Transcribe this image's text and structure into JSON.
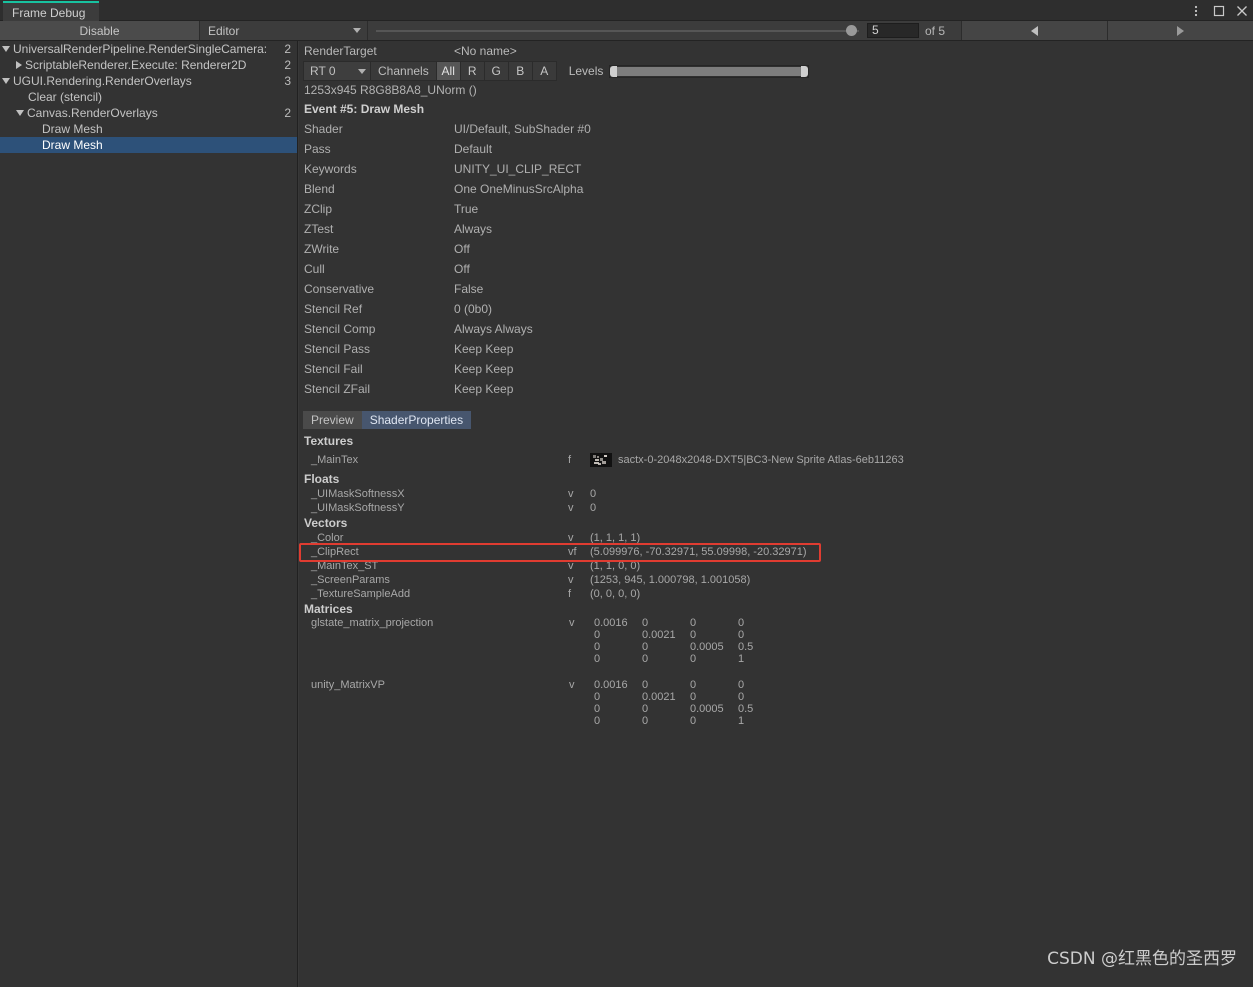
{
  "window": {
    "tab_title": "Frame Debug",
    "accent_color": "#18c2a0",
    "menu_icon": "kebab-menu-icon",
    "maximize_icon": "maximize-icon",
    "close_icon": "close-icon"
  },
  "toolbar": {
    "disable_label": "Disable",
    "context_dropdown": "Editor",
    "event_index_value": "5",
    "event_total_label": "of 5",
    "prev_label": "◀",
    "next_label": "▶",
    "slider_value": 5,
    "slider_max": 5
  },
  "tree": {
    "items": [
      {
        "label": "UniversalRenderPipeline.RenderSingleCamera: I",
        "count": "2",
        "indent": 0,
        "foldout": "open",
        "selected": false
      },
      {
        "label": "ScriptableRenderer.Execute: Renderer2D",
        "count": "2",
        "indent": 1,
        "foldout": "closed",
        "selected": false
      },
      {
        "label": "UGUI.Rendering.RenderOverlays",
        "count": "3",
        "indent": 0,
        "foldout": "open",
        "selected": false
      },
      {
        "label": "Clear (stencil)",
        "count": "",
        "indent": 1,
        "foldout": "none",
        "selected": false
      },
      {
        "label": "Canvas.RenderOverlays",
        "count": "2",
        "indent": 1,
        "foldout": "open",
        "selected": false
      },
      {
        "label": "Draw Mesh",
        "count": "",
        "indent": 2,
        "foldout": "none",
        "selected": false
      },
      {
        "label": "Draw Mesh",
        "count": "",
        "indent": 2,
        "foldout": "none",
        "selected": true
      }
    ],
    "selection_color": "#2d5179"
  },
  "render_target": {
    "header_label": "RenderTarget",
    "header_value": "<No name>",
    "rt_select": "RT 0",
    "channels_label": "Channels",
    "channels": [
      {
        "label": "All",
        "active": true
      },
      {
        "label": "R",
        "active": false
      },
      {
        "label": "G",
        "active": false
      },
      {
        "label": "B",
        "active": false
      },
      {
        "label": "A",
        "active": false
      }
    ],
    "levels_label": "Levels",
    "info": "1253x945 R8G8B8A8_UNorm ()"
  },
  "event": {
    "title": "Event #5: Draw Mesh",
    "properties": [
      {
        "key": "Shader",
        "value": "UI/Default, SubShader #0"
      },
      {
        "key": "Pass",
        "value": "Default"
      },
      {
        "key": "Keywords",
        "value": "UNITY_UI_CLIP_RECT"
      },
      {
        "key": "Blend",
        "value": "One OneMinusSrcAlpha"
      },
      {
        "key": "ZClip",
        "value": "True"
      },
      {
        "key": "ZTest",
        "value": "Always"
      },
      {
        "key": "ZWrite",
        "value": "Off"
      },
      {
        "key": "Cull",
        "value": "Off"
      },
      {
        "key": "Conservative",
        "value": "False"
      },
      {
        "key": "Stencil Ref",
        "value": "0 (0b0)"
      },
      {
        "key": "Stencil Comp",
        "value": "Always Always"
      },
      {
        "key": "Stencil Pass",
        "value": "Keep Keep"
      },
      {
        "key": "Stencil Fail",
        "value": "Keep Keep"
      },
      {
        "key": "Stencil ZFail",
        "value": "Keep Keep"
      }
    ]
  },
  "detail_tabs": [
    {
      "label": "Preview",
      "active": false
    },
    {
      "label": "ShaderProperties",
      "active": true
    }
  ],
  "shader_properties": {
    "textures_head": "Textures",
    "textures": [
      {
        "name": "_MainTex",
        "kind": "f",
        "value": "sactx-0-2048x2048-DXT5|BC3-New Sprite Atlas-6eb11263",
        "thumbnail": "sprite-atlas-thumbnail"
      }
    ],
    "floats_head": "Floats",
    "floats": [
      {
        "name": "_UIMaskSoftnessX",
        "kind": "v",
        "value": "0"
      },
      {
        "name": "_UIMaskSoftnessY",
        "kind": "v",
        "value": "0"
      }
    ],
    "vectors_head": "Vectors",
    "vectors": [
      {
        "name": "_Color",
        "kind": "v",
        "value": "(1, 1, 1, 1)",
        "highlighted": false
      },
      {
        "name": "_ClipRect",
        "kind": "vf",
        "value": "(5.099976, -70.32971, 55.09998, -20.32971)",
        "highlighted": true
      },
      {
        "name": "_MainTex_ST",
        "kind": "v",
        "value": "(1, 1, 0, 0)",
        "highlighted": false
      },
      {
        "name": "_ScreenParams",
        "kind": "v",
        "value": "(1253, 945, 1.000798, 1.001058)",
        "highlighted": false
      },
      {
        "name": "_TextureSampleAdd",
        "kind": "f",
        "value": "(0, 0, 0, 0)",
        "highlighted": false
      }
    ],
    "highlight_color": "#e03c31",
    "matrices_head": "Matrices",
    "matrices": [
      {
        "name": "glstate_matrix_projection",
        "kind": "v",
        "rows": [
          [
            "0.0016",
            "0",
            "0",
            "0"
          ],
          [
            "0",
            "0.0021",
            "0",
            "0"
          ],
          [
            "0",
            "0",
            "0.0005",
            "0.5"
          ],
          [
            "0",
            "0",
            "0",
            "1"
          ]
        ]
      },
      {
        "name": "unity_MatrixVP",
        "kind": "v",
        "rows": [
          [
            "0.0016",
            "0",
            "0",
            "0"
          ],
          [
            "0",
            "0.0021",
            "0",
            "0"
          ],
          [
            "0",
            "0",
            "0.0005",
            "0.5"
          ],
          [
            "0",
            "0",
            "0",
            "1"
          ]
        ]
      }
    ]
  },
  "watermark": "CSDN @红黑色的圣西罗"
}
